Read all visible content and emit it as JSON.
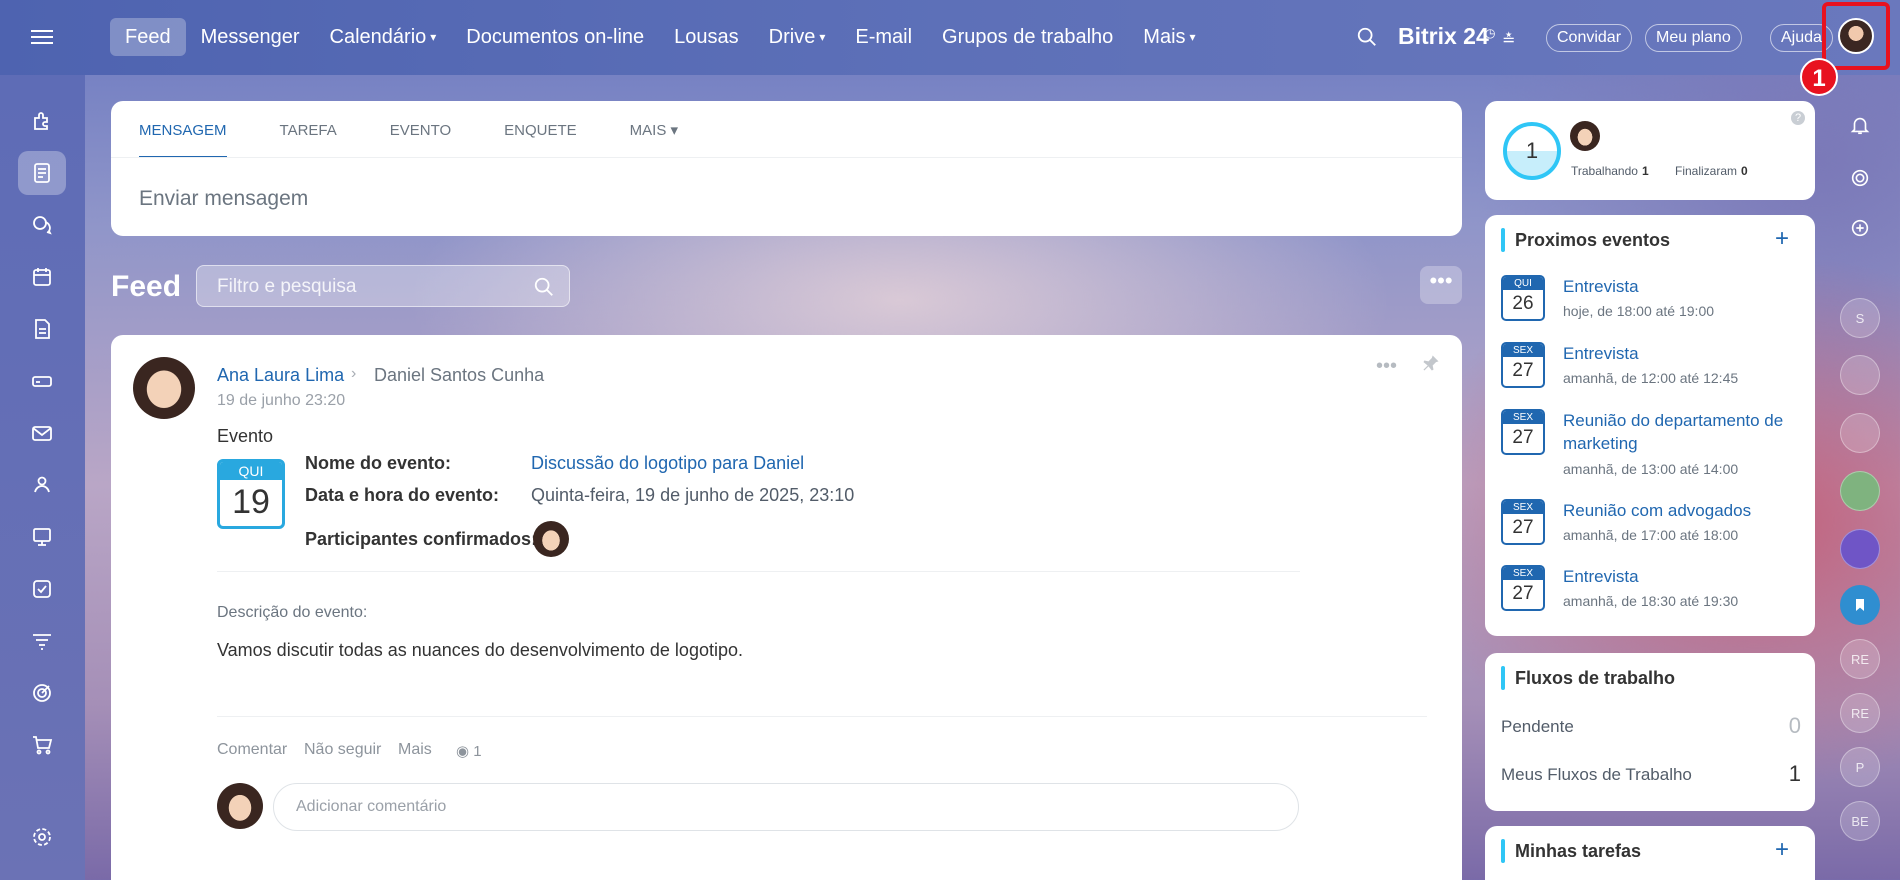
{
  "topbar": {
    "nav": [
      {
        "label": "Feed"
      },
      {
        "label": "Messenger"
      },
      {
        "label": "Calendário",
        "chevron": "▾"
      },
      {
        "label": "Documentos on-line"
      },
      {
        "label": "Lousas"
      },
      {
        "label": "Drive",
        "chevron": "▾"
      },
      {
        "label": "E-mail"
      },
      {
        "label": "Grupos de trabalho"
      },
      {
        "label": "Mais",
        "chevron": "▾"
      }
    ],
    "brand": "Bitrix 24",
    "invite": "Convidar",
    "plan": "Meu plano",
    "help": "Ajuda",
    "step_badge": "1"
  },
  "composer": {
    "tabs": [
      "Mensagem",
      "Tarefa",
      "Evento",
      "Enquete",
      "Mais ▾"
    ],
    "placeholder": "Enviar mensagem"
  },
  "feed": {
    "title": "Feed",
    "filter_placeholder": "Filtro e pesquisa",
    "more": "•••"
  },
  "post": {
    "author": "Ana Laura Lima",
    "recipient": "Daniel Santos Cunha",
    "date": "19 de junho 23:20",
    "type": "Evento",
    "calendar": {
      "day": "QUI",
      "num": "19"
    },
    "event_name_label": "Nome do evento:",
    "event_name": "Discussão do logotipo para Daniel",
    "event_date_label": "Data e hora do evento:",
    "event_date": "Quinta-feira, 19 de junho de 2025, 23:10",
    "participants_label": "Participantes confirmados:",
    "description_label": "Descrição do evento:",
    "description": "Vamos discutir todas as nuances do desenvolvimento de logotipo.",
    "actions": {
      "comment": "Comentar",
      "unfollow": "Não seguir",
      "more": "Mais"
    },
    "views": "1",
    "comment_placeholder": "Adicionar comentário"
  },
  "timeman": {
    "count": "1",
    "working_label": "Trabalhando",
    "working_count": "1",
    "finished_label": "Finalizaram",
    "finished_count": "0"
  },
  "events_widget": {
    "title": "Proximos eventos",
    "items": [
      {
        "day": "QUI",
        "num": "26",
        "title": "Entrevista",
        "time": "hoje, de 18:00 até 19:00"
      },
      {
        "day": "SEX",
        "num": "27",
        "title": "Entrevista",
        "time": "amanhã, de 12:00 até 12:45"
      },
      {
        "day": "SEX",
        "num": "27",
        "title": "Reunião do departamento de marketing",
        "time": "amanhã, de 13:00 até 14:00"
      },
      {
        "day": "SEX",
        "num": "27",
        "title": "Reunião com advogados",
        "time": "amanhã, de 17:00 até 18:00"
      },
      {
        "day": "SEX",
        "num": "27",
        "title": "Entrevista",
        "time": "amanhã, de 18:30 até 19:30"
      }
    ]
  },
  "flows_widget": {
    "title": "Fluxos de trabalho",
    "items": [
      {
        "label": "Pendente",
        "count": "0"
      },
      {
        "label": "Meus Fluxos de Trabalho",
        "count": "1"
      }
    ]
  },
  "tasks_widget": {
    "title": "Minhas tarefas"
  },
  "right_sidebar": {
    "chat_initials": [
      "S",
      "RE",
      "RE",
      "P",
      "BE"
    ]
  },
  "colors": {
    "accent": "#2067b0",
    "highlight": "#e8121f",
    "calendar": "#29a8df",
    "timeman": "#2fc6f6"
  }
}
